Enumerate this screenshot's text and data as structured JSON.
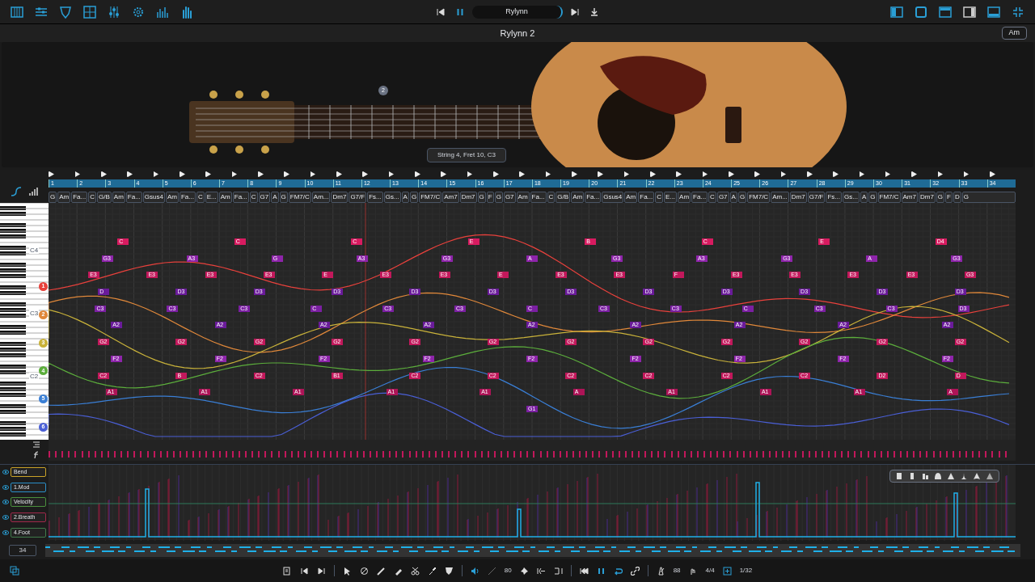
{
  "toolbar": {
    "transport": {
      "song": "Rylynn"
    }
  },
  "title_bar": {
    "title": "Rylynn 2",
    "key": "Am"
  },
  "instrument": {
    "fret_badge": "2",
    "caption": "String 4, Fret 10, C3"
  },
  "ruler": {
    "bars": [
      "1",
      "2",
      "3",
      "4",
      "5",
      "6",
      "7",
      "8",
      "9",
      "10",
      "11",
      "12",
      "13",
      "14",
      "15",
      "16",
      "17",
      "18",
      "19",
      "20",
      "21",
      "22",
      "23",
      "24",
      "25",
      "26",
      "27",
      "28",
      "29",
      "30",
      "31",
      "32",
      "33",
      "34"
    ]
  },
  "chords": [
    "G",
    "Am",
    "Fa...",
    "C",
    "G/B",
    "Am",
    "Fa...",
    "Gsus4",
    "Am",
    "Fa...",
    "C",
    "E...",
    "Am",
    "Fa...",
    "C",
    "G7",
    "A",
    "G",
    "FM7/C",
    "Am...",
    "Dm7",
    "G7/F",
    "Fs...",
    "Gs...",
    "A",
    "G",
    "FM7/C",
    "Am7",
    "Dm7",
    "G",
    "F",
    "G",
    "G7",
    "Am",
    "Fa...",
    "C",
    "G/B",
    "Am",
    "Fa...",
    "Gsus4",
    "Am",
    "Fa...",
    "C",
    "E...",
    "Am",
    "Fa...",
    "C",
    "G7",
    "A",
    "G",
    "FM7/C",
    "Am...",
    "Dm7",
    "G7/F",
    "Fs...",
    "Gs...",
    "A",
    "G",
    "FM7/C",
    "Am7",
    "Dm7",
    "G",
    "F",
    "D",
    "G"
  ],
  "piano": {
    "octaves": [
      "C4",
      "C3",
      "C2"
    ]
  },
  "strings": [
    {
      "label": "1",
      "color": "#e8413c"
    },
    {
      "label": "2",
      "color": "#e0883a"
    },
    {
      "label": "3",
      "color": "#c9b23a"
    },
    {
      "label": "4",
      "color": "#5cae3c"
    },
    {
      "label": "5",
      "color": "#3a7fd6"
    },
    {
      "label": "6",
      "color": "#4a5fd6"
    }
  ],
  "note_rows": [
    {
      "color": "#d81b60",
      "notes": [
        "C",
        "C",
        "C",
        "E",
        "B",
        "C",
        "E",
        "D4"
      ]
    },
    {
      "color": "#8e24aa",
      "notes": [
        "G3",
        "A3",
        "G",
        "A3",
        "G3",
        "A",
        "G3",
        "A3",
        "G3",
        "A",
        "G3"
      ]
    },
    {
      "color": "#c2185b",
      "notes": [
        "E3",
        "E3",
        "E3",
        "E3",
        "E",
        "E3",
        "E3",
        "E",
        "E3",
        "E3",
        "F",
        "E3",
        "E3",
        "E3",
        "E3",
        "G3"
      ]
    },
    {
      "color": "#6a1b9a",
      "notes": [
        "D",
        "D3",
        "D3",
        "D3",
        "D3",
        "D3",
        "D3",
        "D3",
        "D3",
        "D3",
        "D3",
        "D3"
      ]
    },
    {
      "color": "#7b1fa2",
      "notes": [
        "C3",
        "C3",
        "C3",
        "C",
        "C3",
        "C3",
        "C",
        "C3",
        "C3",
        "C",
        "C3",
        "C3",
        "D3"
      ]
    },
    {
      "color": "#6a1b9a",
      "notes": [
        "A2",
        "A2",
        "A2",
        "A2",
        "A2",
        "A2",
        "A2",
        "A2",
        "A2"
      ]
    },
    {
      "color": "#c2185b",
      "notes": [
        "G2",
        "G2",
        "G2",
        "G2",
        "G2",
        "G2",
        "G2",
        "G2",
        "G2",
        "G2",
        "G2",
        "G2"
      ]
    },
    {
      "color": "#8e24aa",
      "notes": [
        "F2",
        "F2",
        "F2",
        "F2",
        "F2",
        "F2",
        "F2",
        "F2",
        "F2"
      ]
    },
    {
      "color": "#c2185b",
      "notes": [
        "C2",
        "B",
        "C2",
        "B1",
        "C2",
        "C2",
        "C2",
        "C2",
        "C2",
        "C2",
        "D2",
        "D"
      ]
    },
    {
      "color": "#ad1457",
      "notes": [
        "A1",
        "A1",
        "A1",
        "A1",
        "A1",
        "A",
        "A1",
        "A1",
        "A1",
        "A"
      ]
    },
    {
      "color": "#7b1fa2",
      "notes": [
        "G1"
      ]
    }
  ],
  "controllers": [
    {
      "label": "Bend",
      "color": "#c9a227",
      "visible": true
    },
    {
      "label": "1.Mod",
      "color": "#2a8fc8",
      "visible": true
    },
    {
      "label": "Velocity",
      "color": "#4a8f3c",
      "visible": true
    },
    {
      "label": "2.Breath",
      "color": "#a0284a",
      "visible": true
    },
    {
      "label": "4.Foot",
      "color": "#3f7a4a",
      "visible": true
    }
  ],
  "overview": {
    "bar_count": "34"
  },
  "bottom_bar": {
    "tempo_feel": "80",
    "tempo": "88",
    "time_signature": "4/4",
    "quantize": "1/32"
  }
}
